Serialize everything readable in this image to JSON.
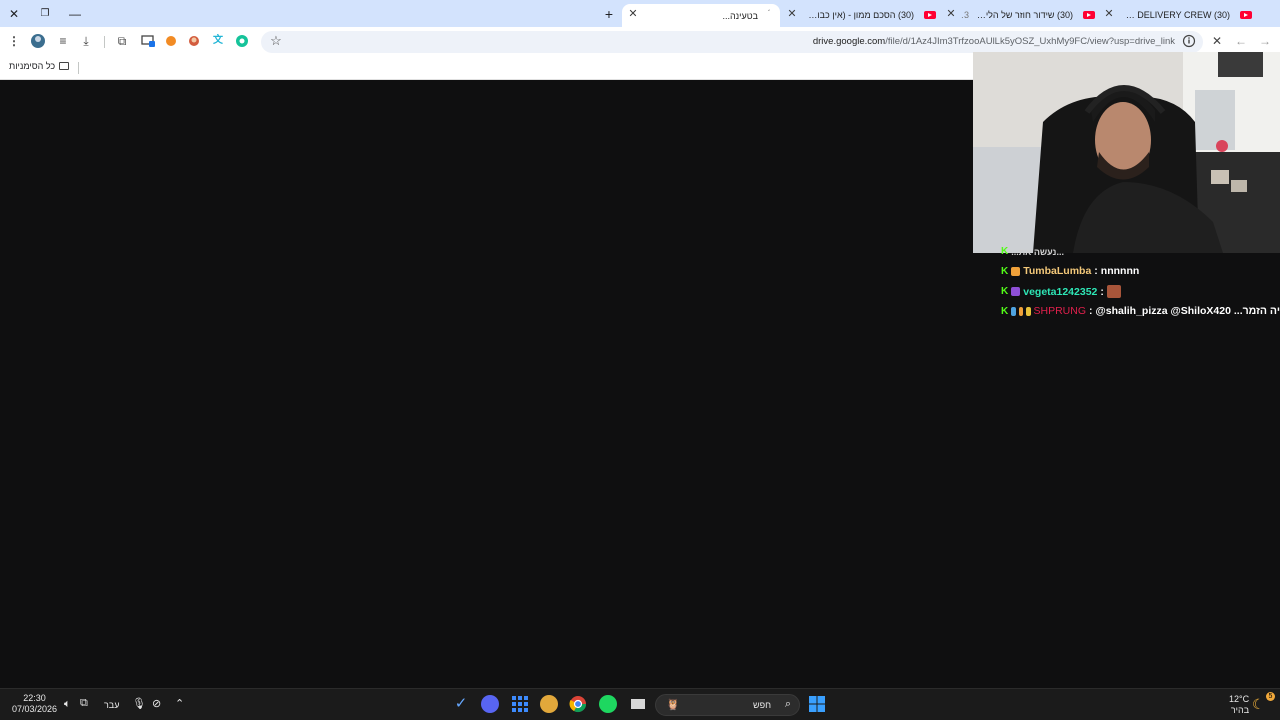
{
  "tabs": [
    {
      "title": "(30) THE DELIVERY CREW",
      "extra": "🍕"
    },
    {
      "title": "(30) שידור חוזר של הלייב של",
      "extra": "23"
    },
    {
      "title": "(30) הסכם ממון - (אין כבוד) - se"
    },
    {
      "title": "בטעינה..."
    }
  ],
  "address_bar": {
    "host": "drive.google.com",
    "path": "/file/d/1Az4JIm3TrfzooAUlLk5yOSZ_UxhMy9FC/view?usp=drive_link"
  },
  "bookmarks": {
    "all_bookmarks": "כל הסימניות"
  },
  "chat": [
    {
      "partial": "...נעשה את..."
    },
    {
      "user": "TumbaLumba",
      "sep": ":",
      "message": "nnnnnn",
      "color": "#f4c97a"
    },
    {
      "user": "vegeta1242352",
      "sep": ":",
      "message": "",
      "color": "#2ee6b6"
    },
    {
      "user": "SHPRUNG",
      "sep": ":",
      "message": "@shalih_pizza @ShiloX420 ...יה הזמר",
      "color": "#e0204c"
    }
  ],
  "taskbar": {
    "time": "22:30",
    "date": "07/03/2026",
    "language": "עבר",
    "search_placeholder": "חפש",
    "weather_temp": "12°C",
    "weather_desc": "בהיר",
    "notif_count": "5"
  },
  "colors": {
    "tabbar": "#d3e3fd",
    "content_bg": "#0f0f10",
    "taskbar": "#1b1b1b",
    "kick_green": "#53fc18"
  }
}
